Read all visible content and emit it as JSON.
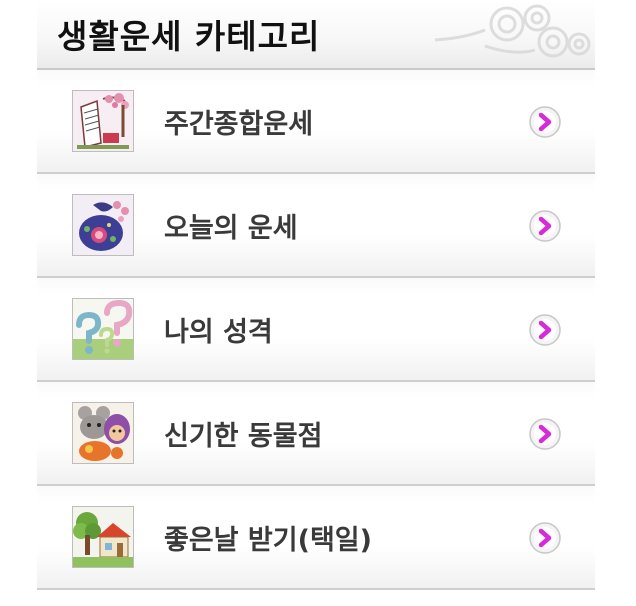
{
  "header": {
    "title": "생활운세 카테고리"
  },
  "colors": {
    "chevron_accent": "#d62bd6",
    "title": "#111111",
    "label": "#3a3a3a"
  },
  "menu": [
    {
      "label": "주간종합운세",
      "icon": "calendar-blossom-icon"
    },
    {
      "label": "오늘의 운세",
      "icon": "lucky-pouch-icon"
    },
    {
      "label": "나의 성격",
      "icon": "question-marks-icon"
    },
    {
      "label": "신기한 동물점",
      "icon": "animals-icon"
    },
    {
      "label": "좋은날 받기(택일)",
      "icon": "house-tree-icon"
    }
  ]
}
